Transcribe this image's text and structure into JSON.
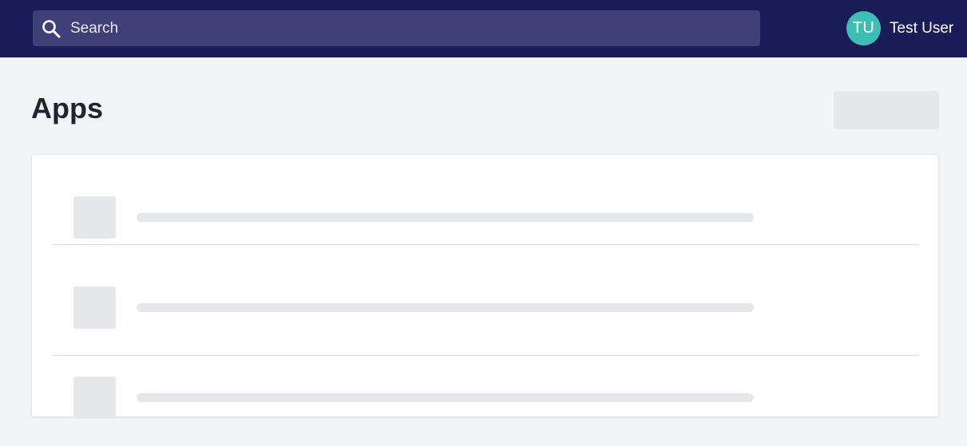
{
  "header": {
    "search": {
      "placeholder": "Search",
      "icon": "search-icon"
    },
    "user": {
      "initials": "TU",
      "name": "Test User",
      "avatar_color": "#3dbdb3"
    },
    "bar_color": "#1a1c57"
  },
  "page": {
    "title": "Apps"
  },
  "app_list": {
    "loading": true,
    "skeleton_rows": 3
  }
}
